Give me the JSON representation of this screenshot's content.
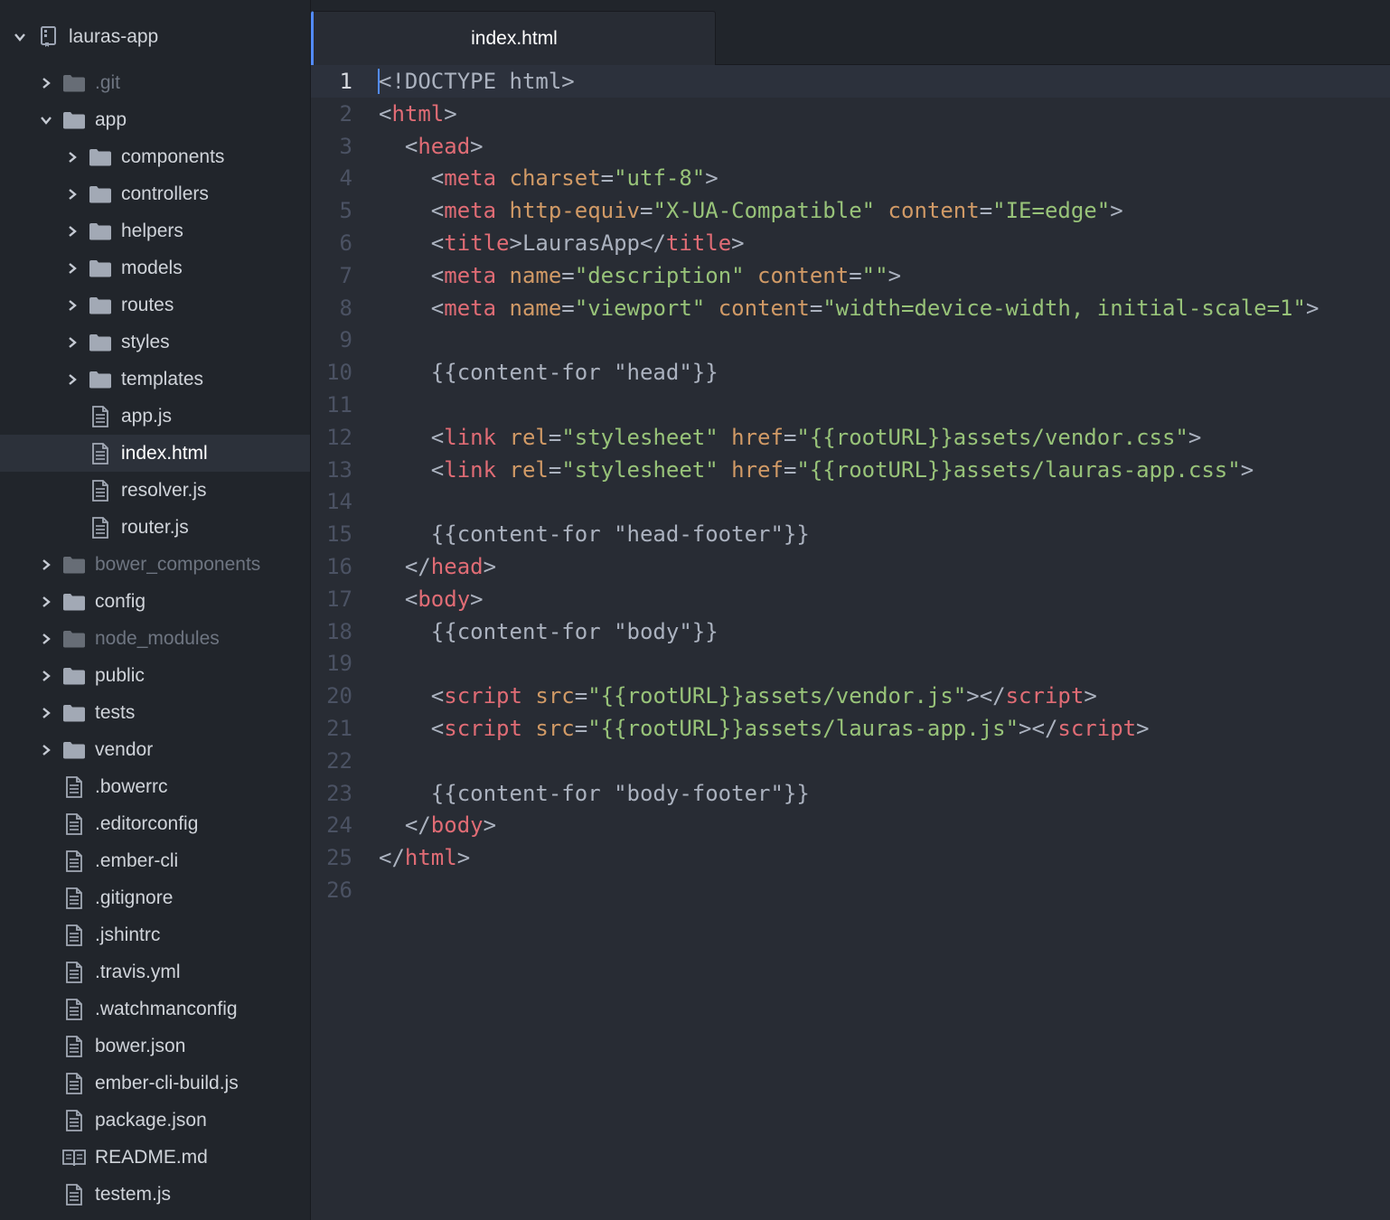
{
  "colors": {
    "background": "#282c34",
    "sidebar": "#21252b",
    "accent": "#528bff",
    "tag": "#e06c75",
    "attribute": "#d19a66",
    "string": "#98c379",
    "text": "#abb2bf",
    "line_number": "#4b5263"
  },
  "tree": {
    "root": {
      "label": "lauras-app",
      "icon": "repo-icon",
      "expanded": true
    },
    "items": [
      {
        "label": ".git",
        "kind": "folder",
        "depth": 1,
        "expanded": false,
        "ignored": true
      },
      {
        "label": "app",
        "kind": "folder",
        "depth": 1,
        "expanded": true
      },
      {
        "label": "components",
        "kind": "folder",
        "depth": 2,
        "expanded": false
      },
      {
        "label": "controllers",
        "kind": "folder",
        "depth": 2,
        "expanded": false
      },
      {
        "label": "helpers",
        "kind": "folder",
        "depth": 2,
        "expanded": false
      },
      {
        "label": "models",
        "kind": "folder",
        "depth": 2,
        "expanded": false
      },
      {
        "label": "routes",
        "kind": "folder",
        "depth": 2,
        "expanded": false
      },
      {
        "label": "styles",
        "kind": "folder",
        "depth": 2,
        "expanded": false
      },
      {
        "label": "templates",
        "kind": "folder",
        "depth": 2,
        "expanded": false
      },
      {
        "label": "app.js",
        "kind": "file",
        "depth": 2
      },
      {
        "label": "index.html",
        "kind": "file",
        "depth": 2,
        "selected": true
      },
      {
        "label": "resolver.js",
        "kind": "file",
        "depth": 2
      },
      {
        "label": "router.js",
        "kind": "file",
        "depth": 2
      },
      {
        "label": "bower_components",
        "kind": "folder",
        "depth": 1,
        "expanded": false,
        "ignored": true
      },
      {
        "label": "config",
        "kind": "folder",
        "depth": 1,
        "expanded": false
      },
      {
        "label": "node_modules",
        "kind": "folder",
        "depth": 1,
        "expanded": false,
        "ignored": true
      },
      {
        "label": "public",
        "kind": "folder",
        "depth": 1,
        "expanded": false
      },
      {
        "label": "tests",
        "kind": "folder",
        "depth": 1,
        "expanded": false
      },
      {
        "label": "vendor",
        "kind": "folder",
        "depth": 1,
        "expanded": false
      },
      {
        "label": ".bowerrc",
        "kind": "file",
        "depth": 1
      },
      {
        "label": ".editorconfig",
        "kind": "file",
        "depth": 1
      },
      {
        "label": ".ember-cli",
        "kind": "file",
        "depth": 1
      },
      {
        "label": ".gitignore",
        "kind": "file",
        "depth": 1
      },
      {
        "label": ".jshintrc",
        "kind": "file",
        "depth": 1
      },
      {
        "label": ".travis.yml",
        "kind": "file",
        "depth": 1
      },
      {
        "label": ".watchmanconfig",
        "kind": "file",
        "depth": 1
      },
      {
        "label": "bower.json",
        "kind": "file",
        "depth": 1
      },
      {
        "label": "ember-cli-build.js",
        "kind": "file",
        "depth": 1
      },
      {
        "label": "package.json",
        "kind": "file",
        "depth": 1
      },
      {
        "label": "README.md",
        "kind": "book",
        "depth": 1
      },
      {
        "label": "testem.js",
        "kind": "file",
        "depth": 1
      }
    ]
  },
  "tabs": [
    {
      "label": "index.html",
      "active": true
    }
  ],
  "editor": {
    "cursor_line": 1,
    "lines": [
      [
        [
          "p",
          "<!DOCTYPE html>"
        ]
      ],
      [
        [
          "p",
          "<"
        ],
        [
          "t",
          "html"
        ],
        [
          "p",
          ">"
        ]
      ],
      [
        [
          "p",
          "  <"
        ],
        [
          "t",
          "head"
        ],
        [
          "p",
          ">"
        ]
      ],
      [
        [
          "p",
          "    <"
        ],
        [
          "t",
          "meta"
        ],
        [
          "p",
          " "
        ],
        [
          "a",
          "charset"
        ],
        [
          "p",
          "="
        ],
        [
          "s",
          "\"utf-8\""
        ],
        [
          "p",
          ">"
        ]
      ],
      [
        [
          "p",
          "    <"
        ],
        [
          "t",
          "meta"
        ],
        [
          "p",
          " "
        ],
        [
          "a",
          "http-equiv"
        ],
        [
          "p",
          "="
        ],
        [
          "s",
          "\"X-UA-Compatible\""
        ],
        [
          "p",
          " "
        ],
        [
          "a",
          "content"
        ],
        [
          "p",
          "="
        ],
        [
          "s",
          "\"IE=edge\""
        ],
        [
          "p",
          ">"
        ]
      ],
      [
        [
          "p",
          "    <"
        ],
        [
          "t",
          "title"
        ],
        [
          "p",
          ">LaurasApp</"
        ],
        [
          "t",
          "title"
        ],
        [
          "p",
          ">"
        ]
      ],
      [
        [
          "p",
          "    <"
        ],
        [
          "t",
          "meta"
        ],
        [
          "p",
          " "
        ],
        [
          "a",
          "name"
        ],
        [
          "p",
          "="
        ],
        [
          "s",
          "\"description\""
        ],
        [
          "p",
          " "
        ],
        [
          "a",
          "content"
        ],
        [
          "p",
          "="
        ],
        [
          "s",
          "\"\""
        ],
        [
          "p",
          ">"
        ]
      ],
      [
        [
          "p",
          "    <"
        ],
        [
          "t",
          "meta"
        ],
        [
          "p",
          " "
        ],
        [
          "a",
          "name"
        ],
        [
          "p",
          "="
        ],
        [
          "s",
          "\"viewport\""
        ],
        [
          "p",
          " "
        ],
        [
          "a",
          "content"
        ],
        [
          "p",
          "="
        ],
        [
          "s",
          "\"width=device-width, initial-scale=1\""
        ],
        [
          "p",
          ">"
        ]
      ],
      [],
      [
        [
          "p",
          "    {{content-for \"head\"}}"
        ]
      ],
      [],
      [
        [
          "p",
          "    <"
        ],
        [
          "t",
          "link"
        ],
        [
          "p",
          " "
        ],
        [
          "a",
          "rel"
        ],
        [
          "p",
          "="
        ],
        [
          "s",
          "\"stylesheet\""
        ],
        [
          "p",
          " "
        ],
        [
          "a",
          "href"
        ],
        [
          "p",
          "="
        ],
        [
          "s",
          "\"{{rootURL}}assets/vendor.css\""
        ],
        [
          "p",
          ">"
        ]
      ],
      [
        [
          "p",
          "    <"
        ],
        [
          "t",
          "link"
        ],
        [
          "p",
          " "
        ],
        [
          "a",
          "rel"
        ],
        [
          "p",
          "="
        ],
        [
          "s",
          "\"stylesheet\""
        ],
        [
          "p",
          " "
        ],
        [
          "a",
          "href"
        ],
        [
          "p",
          "="
        ],
        [
          "s",
          "\"{{rootURL}}assets/lauras-app.css\""
        ],
        [
          "p",
          ">"
        ]
      ],
      [],
      [
        [
          "p",
          "    {{content-for \"head-footer\"}}"
        ]
      ],
      [
        [
          "p",
          "  </"
        ],
        [
          "t",
          "head"
        ],
        [
          "p",
          ">"
        ]
      ],
      [
        [
          "p",
          "  <"
        ],
        [
          "t",
          "body"
        ],
        [
          "p",
          ">"
        ]
      ],
      [
        [
          "p",
          "    {{content-for \"body\"}}"
        ]
      ],
      [],
      [
        [
          "p",
          "    <"
        ],
        [
          "t",
          "script"
        ],
        [
          "p",
          " "
        ],
        [
          "a",
          "src"
        ],
        [
          "p",
          "="
        ],
        [
          "s",
          "\"{{rootURL}}assets/vendor.js\""
        ],
        [
          "p",
          "></"
        ],
        [
          "t",
          "script"
        ],
        [
          "p",
          ">"
        ]
      ],
      [
        [
          "p",
          "    <"
        ],
        [
          "t",
          "script"
        ],
        [
          "p",
          " "
        ],
        [
          "a",
          "src"
        ],
        [
          "p",
          "="
        ],
        [
          "s",
          "\"{{rootURL}}assets/lauras-app.js\""
        ],
        [
          "p",
          "></"
        ],
        [
          "t",
          "script"
        ],
        [
          "p",
          ">"
        ]
      ],
      [],
      [
        [
          "p",
          "    {{content-for \"body-footer\"}}"
        ]
      ],
      [
        [
          "p",
          "  </"
        ],
        [
          "t",
          "body"
        ],
        [
          "p",
          ">"
        ]
      ],
      [
        [
          "p",
          "</"
        ],
        [
          "t",
          "html"
        ],
        [
          "p",
          ">"
        ]
      ],
      []
    ]
  }
}
